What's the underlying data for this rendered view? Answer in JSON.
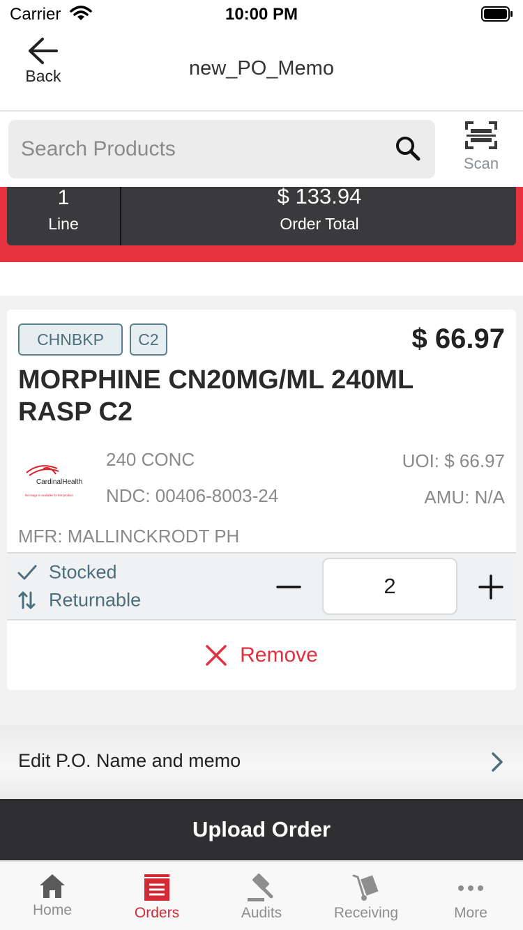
{
  "status_bar": {
    "carrier": "Carrier",
    "time": "10:00 PM"
  },
  "nav": {
    "back_label": "Back",
    "title": "new_PO_Memo"
  },
  "search": {
    "placeholder": "Search Products",
    "value": "",
    "scan_label": "Scan"
  },
  "summary": {
    "lines_count": "1",
    "lines_label": "Line",
    "order_total": "$ 133.94",
    "order_total_label": "Order Total"
  },
  "product": {
    "tags": [
      "CHNBKP",
      "C2"
    ],
    "price": "$ 66.97",
    "name": "MORPHINE CN20MG/ML 240ML RASP  C2",
    "size": "240 CONC",
    "ndc": "NDC: 00406-8003-24",
    "uoi": "UOI: $ 66.97",
    "amu": "AMU: N/A",
    "mfr": "MFR: MALLINCKRODT PH",
    "logo_brand": "CardinalHealth",
    "logo_note": "No image is available for this product",
    "stocked_label": "Stocked",
    "returnable_label": "Returnable",
    "quantity": "2",
    "remove_label": "Remove"
  },
  "edit_row": {
    "label": "Edit P.O. Name and memo"
  },
  "upload": {
    "label": "Upload Order"
  },
  "tabs": [
    {
      "label": "Home",
      "icon": "home-icon",
      "active": false
    },
    {
      "label": "Orders",
      "icon": "orders-icon",
      "active": true
    },
    {
      "label": "Audits",
      "icon": "gavel-icon",
      "active": false
    },
    {
      "label": "Receiving",
      "icon": "hand-truck-icon",
      "active": false
    },
    {
      "label": "More",
      "icon": "more-dots-icon",
      "active": false
    }
  ],
  "colors": {
    "accent_red": "#e8323f",
    "dark_bar": "#3a3a3c",
    "tag_teal": "#4c6f7d",
    "active_tab": "#d42a36"
  }
}
